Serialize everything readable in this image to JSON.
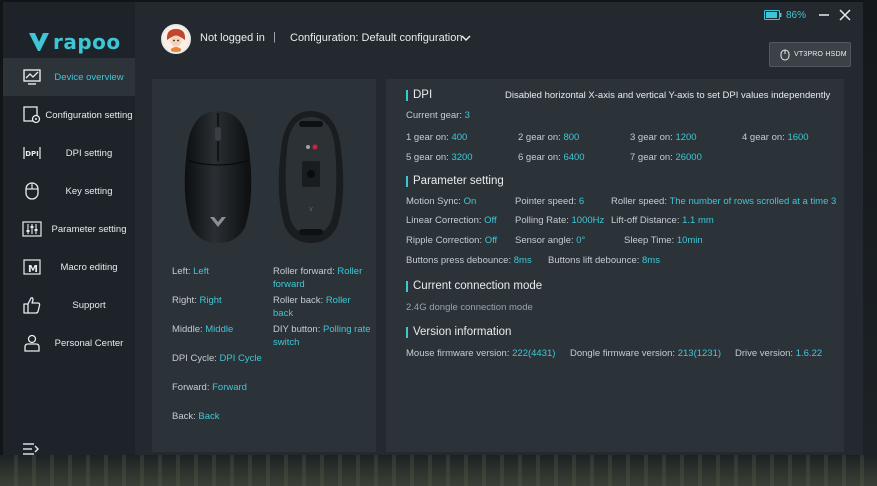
{
  "brand": {
    "logo_text": "rapoo"
  },
  "header": {
    "login_status": "Not logged in",
    "separator": "|",
    "configuration_label": "Configuration: Default configuration",
    "battery_percent": "86%",
    "device_name": "VT3PRO HSDM"
  },
  "sidebar": {
    "items": [
      {
        "label": "Device overview",
        "icon": "monitor-chart-icon",
        "active": true
      },
      {
        "label": "Configuration setting",
        "icon": "config-gear-icon"
      },
      {
        "label": "DPI setting",
        "icon": "dpi-icon"
      },
      {
        "label": "Key setting",
        "icon": "mouse-icon"
      },
      {
        "label": "Parameter setting",
        "icon": "sliders-icon"
      },
      {
        "label": "Macro editing",
        "icon": "macro-icon"
      },
      {
        "label": "Support",
        "icon": "thumbs-up-icon"
      },
      {
        "label": "Personal Center",
        "icon": "person-icon"
      }
    ]
  },
  "buttons": {
    "left_label": "Left:",
    "left_value": "Left",
    "right_label": "Right:",
    "right_value": "Right",
    "middle_label": "Middle:",
    "middle_value": "Middle",
    "dpi_cycle_label": "DPI Cycle:",
    "dpi_cycle_value": "DPI Cycle",
    "forward_label": "Forward:",
    "forward_value": "Forward",
    "back_label": "Back:",
    "back_value": "Back",
    "roller_forward_label": "Roller forward:",
    "roller_forward_value_1": "Roller",
    "roller_forward_value_2": "forward",
    "roller_back_label": "Roller back:",
    "roller_back_value_1": "Roller",
    "roller_back_value_2": "back",
    "diy_label": "DIY button:",
    "diy_value_1": "Polling rate",
    "diy_value_2": "switch"
  },
  "dpi": {
    "title": "DPI",
    "note": "Disabled horizontal X-axis and vertical Y-axis to set DPI values independently",
    "current_gear_label": "Current gear:",
    "current_gear": "3",
    "gears": [
      {
        "label": "1 gear on:",
        "value": "400"
      },
      {
        "label": "2 gear on:",
        "value": "800"
      },
      {
        "label": "3 gear on:",
        "value": "1200"
      },
      {
        "label": "4 gear on:",
        "value": "1600"
      },
      {
        "label": "5 gear on:",
        "value": "3200"
      },
      {
        "label": "6 gear on:",
        "value": "6400"
      },
      {
        "label": "7 gear on:",
        "value": "26000"
      }
    ]
  },
  "params": {
    "title": "Parameter setting",
    "motion_sync_label": "Motion Sync:",
    "motion_sync": "On",
    "pointer_speed_label": "Pointer speed:",
    "pointer_speed": "6",
    "roller_speed_label": "Roller speed:",
    "roller_speed": "The number of rows scrolled at a time 3",
    "linear_label": "Linear Correction:",
    "linear": "Off",
    "polling_label": "Polling Rate:",
    "polling": "1000Hz",
    "liftoff_label": "Lift-off Distance:",
    "liftoff": "1.1 mm",
    "ripple_label": "Ripple Correction:",
    "ripple": "Off",
    "sensor_angle_label": "Sensor angle:",
    "sensor_angle": "0°",
    "sleep_label": "Sleep Time:",
    "sleep": "10min",
    "press_debounce_label": "Buttons press debounce:",
    "press_debounce": "8ms",
    "lift_debounce_label": "Buttons lift debounce:",
    "lift_debounce": "8ms"
  },
  "connection": {
    "title": "Current connection mode",
    "mode": "2.4G dongle connection mode"
  },
  "version": {
    "title": "Version information",
    "mouse_fw_label": "Mouse firmware version:",
    "mouse_fw": "222(4431)",
    "dongle_fw_label": "Dongle firmware version:",
    "dongle_fw": "213(1231)",
    "drive_label": "Drive version:",
    "drive": "1.6.22"
  },
  "colors": {
    "accent": "#3fc6d6",
    "panel": "#2c3338",
    "sidebar": "#1d2328"
  }
}
